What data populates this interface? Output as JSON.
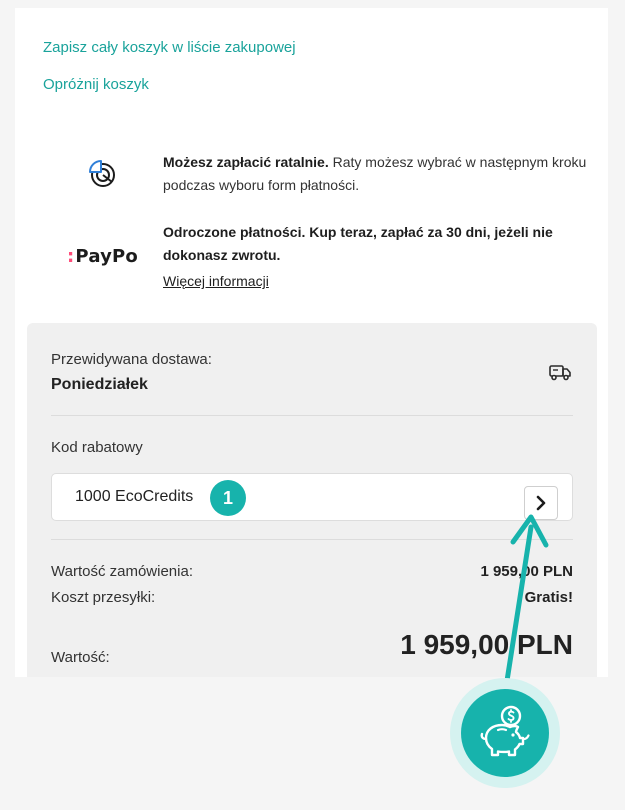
{
  "cart_actions": {
    "save_cart": "Zapisz cały koszyk w liście zakupowej",
    "empty_cart": "Opróżnij koszyk"
  },
  "payment_info": {
    "installments_bold": "Możesz zapłacić ratalnie.",
    "installments_text": " Raty możesz wybrać w następnym kroku podczas wyboru form płatności.",
    "paypo_logo": "PayPo",
    "paypo_bold": "Odroczone płatności. Kup teraz, zapłać za 30 dni, jeżeli nie dokonasz zwrotu.",
    "paypo_link": "Więcej informacji"
  },
  "delivery": {
    "label": "Przewidywana dostawa:",
    "day": "Poniedziałek"
  },
  "discount": {
    "label": "Kod rabatowy",
    "value": "1000 EcoCredits",
    "step_badge": "1"
  },
  "totals": {
    "order_value_label": "Wartość zamówienia:",
    "order_value": "1 959,00 PLN",
    "shipping_label": "Koszt przesyłki:",
    "shipping_value": "Gratis!",
    "total_label": "Wartość:",
    "total_value": "1 959,00 PLN"
  },
  "colors": {
    "accent": "#17b3ac",
    "link": "#1aa39b",
    "paypo_dots": "#ff4d7a"
  },
  "icons": [
    "installments-pie-icon",
    "paypo-logo",
    "truck-icon",
    "chevron-right-icon",
    "piggy-bank-coin-icon",
    "pointer-arrow"
  ]
}
